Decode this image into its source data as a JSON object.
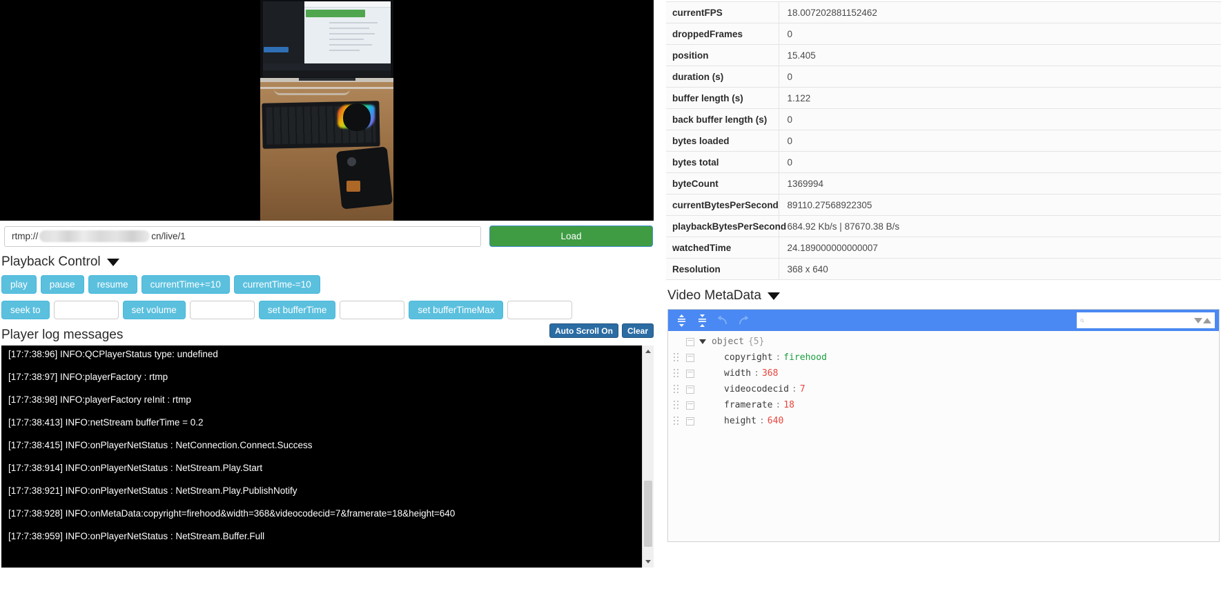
{
  "player": {
    "url_prefix": "rtmp://",
    "url_redacted": true,
    "url_suffix": "cn/live/1",
    "load_label": "Load",
    "url_placeholder": "rtmp://.../live/1"
  },
  "playback_control": {
    "heading": "Playback Control",
    "caret_icon": "caret-down-icon",
    "row1": [
      {
        "label": "play"
      },
      {
        "label": "pause"
      },
      {
        "label": "resume"
      },
      {
        "label": "currentTime+=10"
      },
      {
        "label": "currentTime-=10"
      }
    ],
    "row2": [
      {
        "label": "seek to",
        "value": "",
        "placeholder": ""
      },
      {
        "label": "set volume",
        "value": "",
        "placeholder": ""
      },
      {
        "label": "set bufferTime",
        "value": "",
        "placeholder": ""
      },
      {
        "label": "set bufferTimeMax",
        "value": "",
        "placeholder": ""
      }
    ]
  },
  "log_panel": {
    "title": "Player log messages",
    "auto_scroll_label": "Auto Scroll On",
    "clear_label": "Clear",
    "lines": [
      "[17:7:38:96] INFO:QCPlayerStatus type: undefined",
      "[17:7:38:97] INFO:playerFactory : rtmp",
      "[17:7:38:98] INFO:playerFactory reInit : rtmp",
      "[17:7:38:413] INFO:netStream bufferTime = 0.2",
      "[17:7:38:415] INFO:onPlayerNetStatus : NetConnection.Connect.Success",
      "[17:7:38:914] INFO:onPlayerNetStatus : NetStream.Play.Start",
      "[17:7:38:921] INFO:onPlayerNetStatus : NetStream.Play.PublishNotify",
      "[17:7:38:928] INFO:onMetaData:copyright=firehood&width=368&videocodecid=7&framerate=18&height=640",
      "[17:7:38:959] INFO:onPlayerNetStatus : NetStream.Buffer.Full"
    ]
  },
  "stats": {
    "rows": [
      {
        "label": "currentFPS",
        "value": "18.007202881152462"
      },
      {
        "label": "droppedFrames",
        "value": "0"
      },
      {
        "label": "position",
        "value": "15.405"
      },
      {
        "label": "duration (s)",
        "value": "0"
      },
      {
        "label": "buffer length (s)",
        "value": "1.122"
      },
      {
        "label": "back buffer length (s)",
        "value": "0"
      },
      {
        "label": "bytes loaded",
        "value": "0"
      },
      {
        "label": "bytes total",
        "value": "0"
      },
      {
        "label": "byteCount",
        "value": "1369994"
      },
      {
        "label": "currentBytesPerSecond",
        "value": "89110.27568922305"
      },
      {
        "label": "playbackBytesPerSecond",
        "value": "684.92 Kb/s | 87670.38 B/s"
      },
      {
        "label": "watchedTime",
        "value": "24.189000000000007"
      },
      {
        "label": "Resolution",
        "value": "368 x 640"
      }
    ]
  },
  "metadata": {
    "heading": "Video MetaData",
    "caret_icon": "caret-down-icon",
    "toolbar": {
      "expand_all_icon": "expand-all-icon",
      "collapse_all_icon": "collapse-all-icon",
      "undo_icon": "undo-icon",
      "redo_icon": "redo-icon",
      "search_icon": "search-icon",
      "search_next_icon": "chevron-down-icon",
      "search_prev_icon": "chevron-up-icon",
      "search_value": "",
      "search_placeholder": ""
    },
    "root_label": "object",
    "root_count": "{5}",
    "entries": [
      {
        "key": "copyright",
        "value": "firehood",
        "type": "string"
      },
      {
        "key": "width",
        "value": "368",
        "type": "number"
      },
      {
        "key": "videocodecid",
        "value": "7",
        "type": "number"
      },
      {
        "key": "framerate",
        "value": "18",
        "type": "number"
      },
      {
        "key": "height",
        "value": "640",
        "type": "number"
      }
    ]
  },
  "colors": {
    "accent_blue": "#4a89f3",
    "button_cyan": "#5bc0de",
    "button_green": "#3f9c43",
    "button_dark_blue": "#2b6ca3",
    "json_string": "#1a9e3e",
    "json_number": "#e8453c"
  }
}
